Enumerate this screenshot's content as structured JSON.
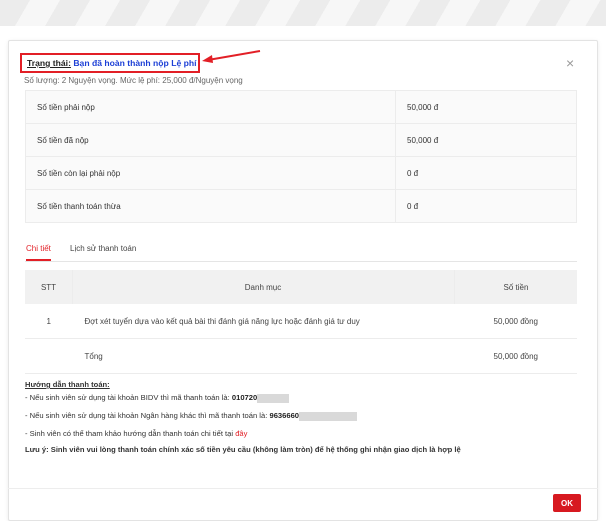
{
  "status": {
    "label": "Trạng thái:",
    "value": "Bạn đã hoàn thành nộp Lệ phí"
  },
  "subinfo": "Số lượng: 2 Nguyện vọng. Mức lệ phí: 25,000 đ/Nguyện vọng",
  "summary": [
    {
      "label": "Số tiền phải nộp",
      "value": "50,000 đ"
    },
    {
      "label": "Số tiền đã nộp",
      "value": "50,000 đ"
    },
    {
      "label": "Số tiền còn lại phải nộp",
      "value": "0 đ"
    },
    {
      "label": "Số tiền thanh toán thừa",
      "value": "0 đ"
    }
  ],
  "tabs": {
    "detail": "Chi tiết",
    "history": "Lịch sử thanh toán"
  },
  "detail_table": {
    "headers": {
      "stt": "STT",
      "category": "Danh mục",
      "amount": "Số tiền"
    },
    "rows": [
      {
        "stt": "1",
        "category": "Đợt xét tuyển dựa vào kết quả bài thi đánh giá năng lực hoặc đánh giá tư duy",
        "amount": "50,000 đồng"
      }
    ],
    "total": {
      "label": "Tổng",
      "amount": "50,000 đồng"
    }
  },
  "guide": {
    "title": "Hướng dẫn thanh toán:",
    "bidv_text": "- Nếu sinh viên sử dụng tài khoản BIDV thì mã thanh toán là:",
    "bidv_code": "010720",
    "other_text": "- Nếu sinh viên sử dụng tài khoản Ngân hàng khác thì mã thanh toán là:",
    "other_code": "9636660",
    "ref_text": "- Sinh viên có thể tham khảo hướng dẫn thanh toán chi tiết tại",
    "ref_link": "đây",
    "note": "Lưu ý: Sinh viên vui lòng thanh toán chính xác số tiền yêu cầu (không làm tròn) để hệ thống ghi nhận giao dịch là hợp lệ"
  },
  "buttons": {
    "ok": "OK",
    "close": "×"
  },
  "colors": {
    "accent": "#e21f26",
    "status_value": "#1c3fd6"
  }
}
